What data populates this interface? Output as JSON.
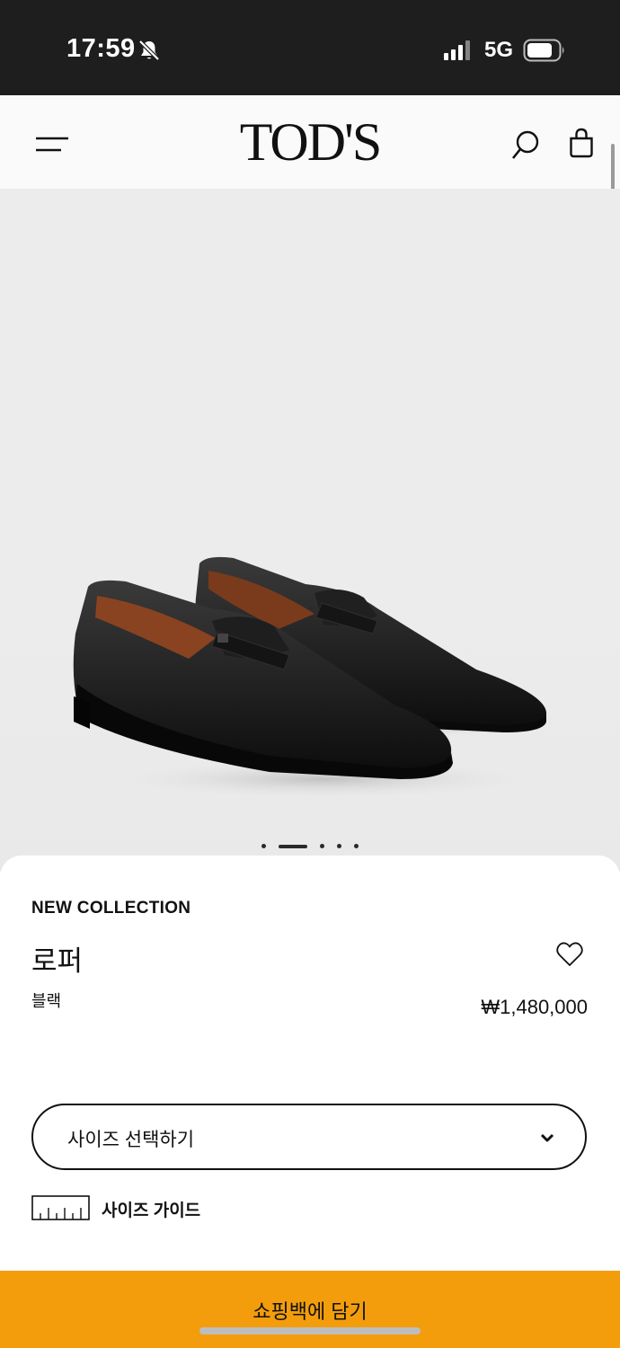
{
  "status_bar": {
    "time": "17:59",
    "network": "5G",
    "icons": [
      "bell-slash-icon",
      "signal-icon",
      "battery-icon"
    ]
  },
  "header": {
    "brand": "TOD'S",
    "icons": [
      "menu-icon",
      "search-icon",
      "bag-icon"
    ]
  },
  "gallery": {
    "image": "black-penny-loafers-pair",
    "slide_count": 5,
    "active_slide": 2
  },
  "product": {
    "collection": "NEW COLLECTION",
    "name": "로퍼",
    "color": "블랙",
    "price": "₩1,480,000"
  },
  "size_select": {
    "placeholder": "사이즈 선택하기"
  },
  "size_guide": {
    "label": "사이즈 가이드"
  },
  "cta": {
    "label": "쇼핑백에 담기",
    "color": "#f39d0c"
  }
}
